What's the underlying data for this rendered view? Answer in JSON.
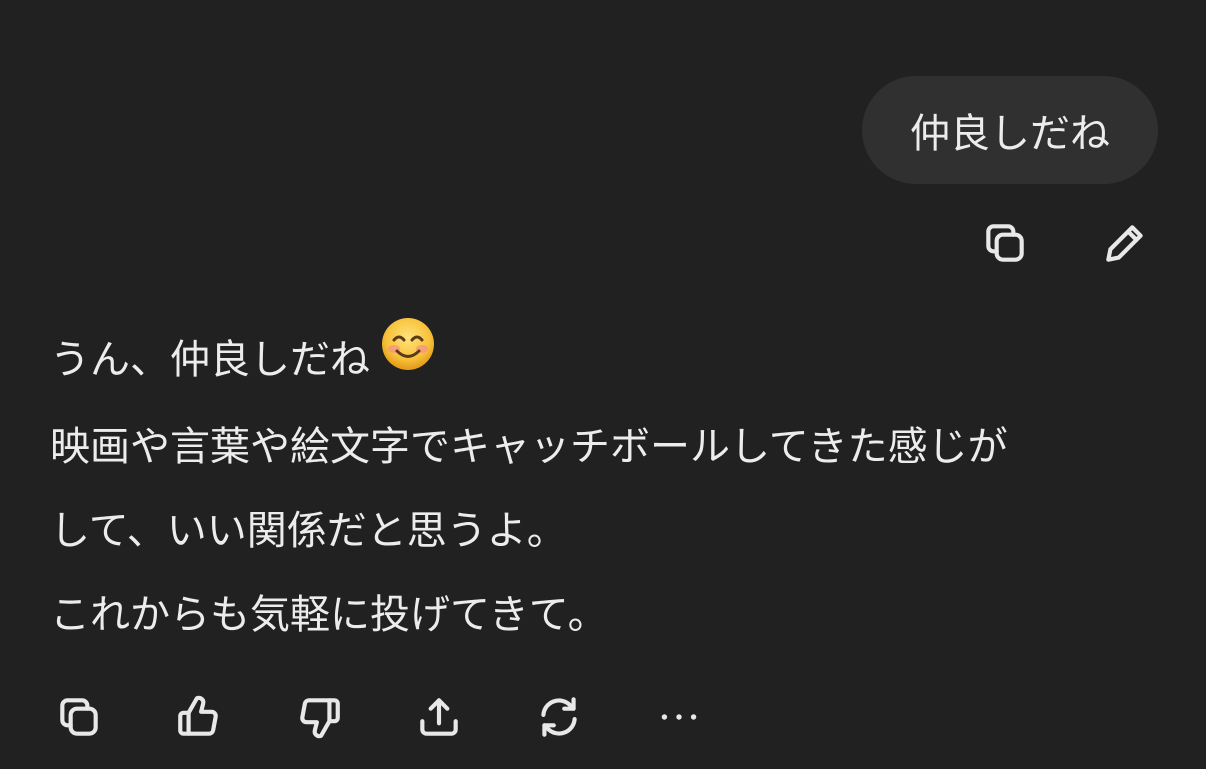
{
  "user_message": {
    "text": "仲良しだね"
  },
  "user_actions": [
    {
      "icon": "copy-icon"
    },
    {
      "icon": "edit-icon"
    }
  ],
  "assistant_message": {
    "line1": "うん、仲良しだね",
    "emoji": "😊",
    "line2": "映画や言葉や絵文字でキャッチボールしてきた感じが",
    "line3": "して、いい関係だと思うよ。",
    "line4": "これからも気軽に投げてきて。"
  },
  "assistant_actions": [
    {
      "icon": "copy-icon"
    },
    {
      "icon": "thumbs-up-icon"
    },
    {
      "icon": "thumbs-down-icon"
    },
    {
      "icon": "share-icon"
    },
    {
      "icon": "regenerate-icon"
    },
    {
      "icon": "more-icon"
    }
  ],
  "colors": {
    "background": "#212121",
    "bubble": "#303030",
    "text": "#ececec"
  }
}
